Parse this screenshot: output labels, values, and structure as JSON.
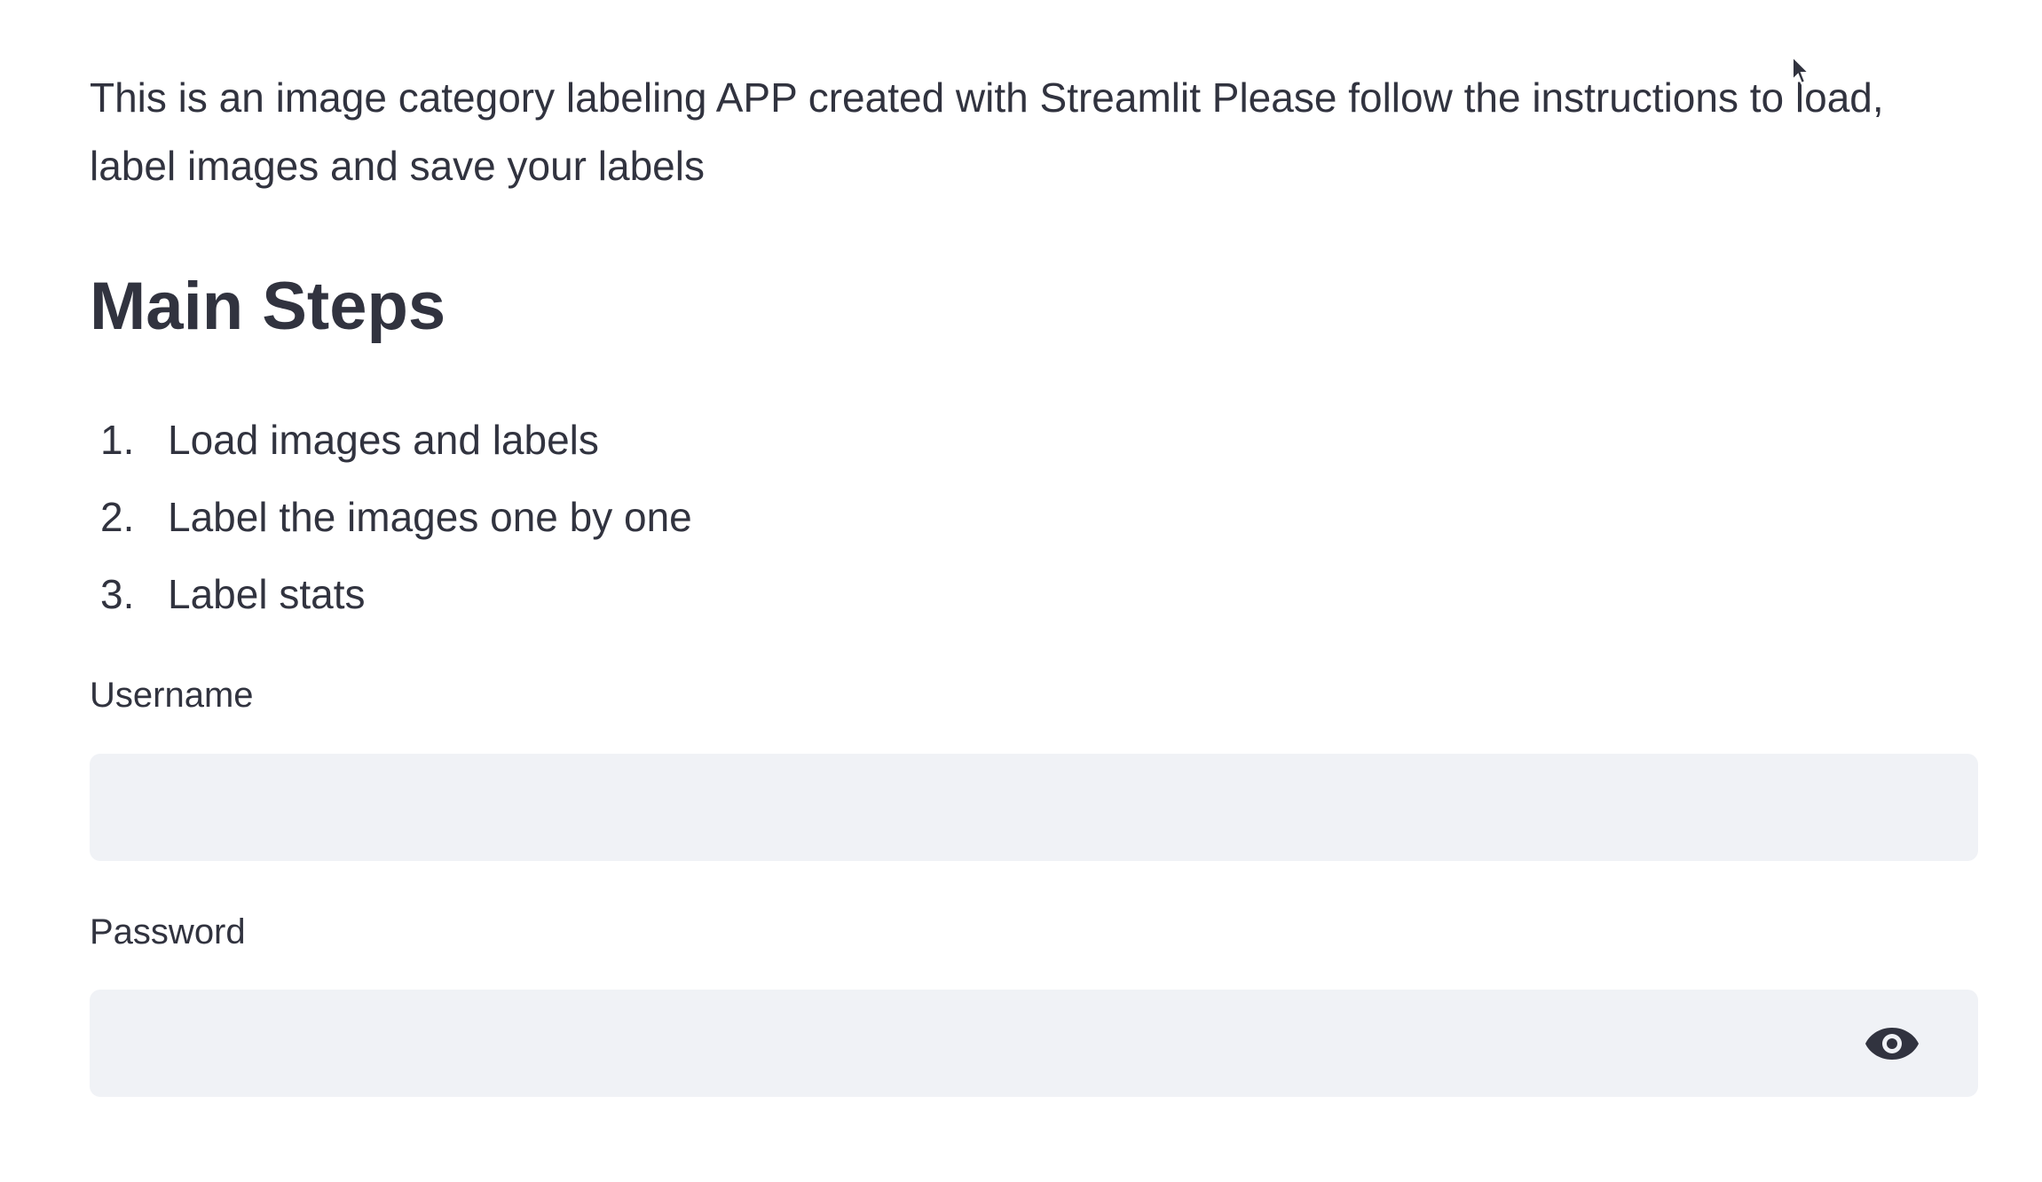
{
  "intro": {
    "text": "This is an image category labeling APP created with Streamlit Please follow the instructions to load, label images and save your labels"
  },
  "main_steps": {
    "heading": "Main Steps",
    "items": [
      {
        "number": "1.",
        "label": "Load images and labels"
      },
      {
        "number": "2.",
        "label": "Label the images one by one"
      },
      {
        "number": "3.",
        "label": "Label stats"
      }
    ]
  },
  "form": {
    "username": {
      "label": "Username",
      "value": "",
      "placeholder": ""
    },
    "password": {
      "label": "Password",
      "value": "",
      "placeholder": "",
      "toggle_icon": "eye-icon"
    }
  },
  "colors": {
    "text": "#31333F",
    "input_background": "#F0F2F6",
    "background": "#FFFFFF"
  }
}
